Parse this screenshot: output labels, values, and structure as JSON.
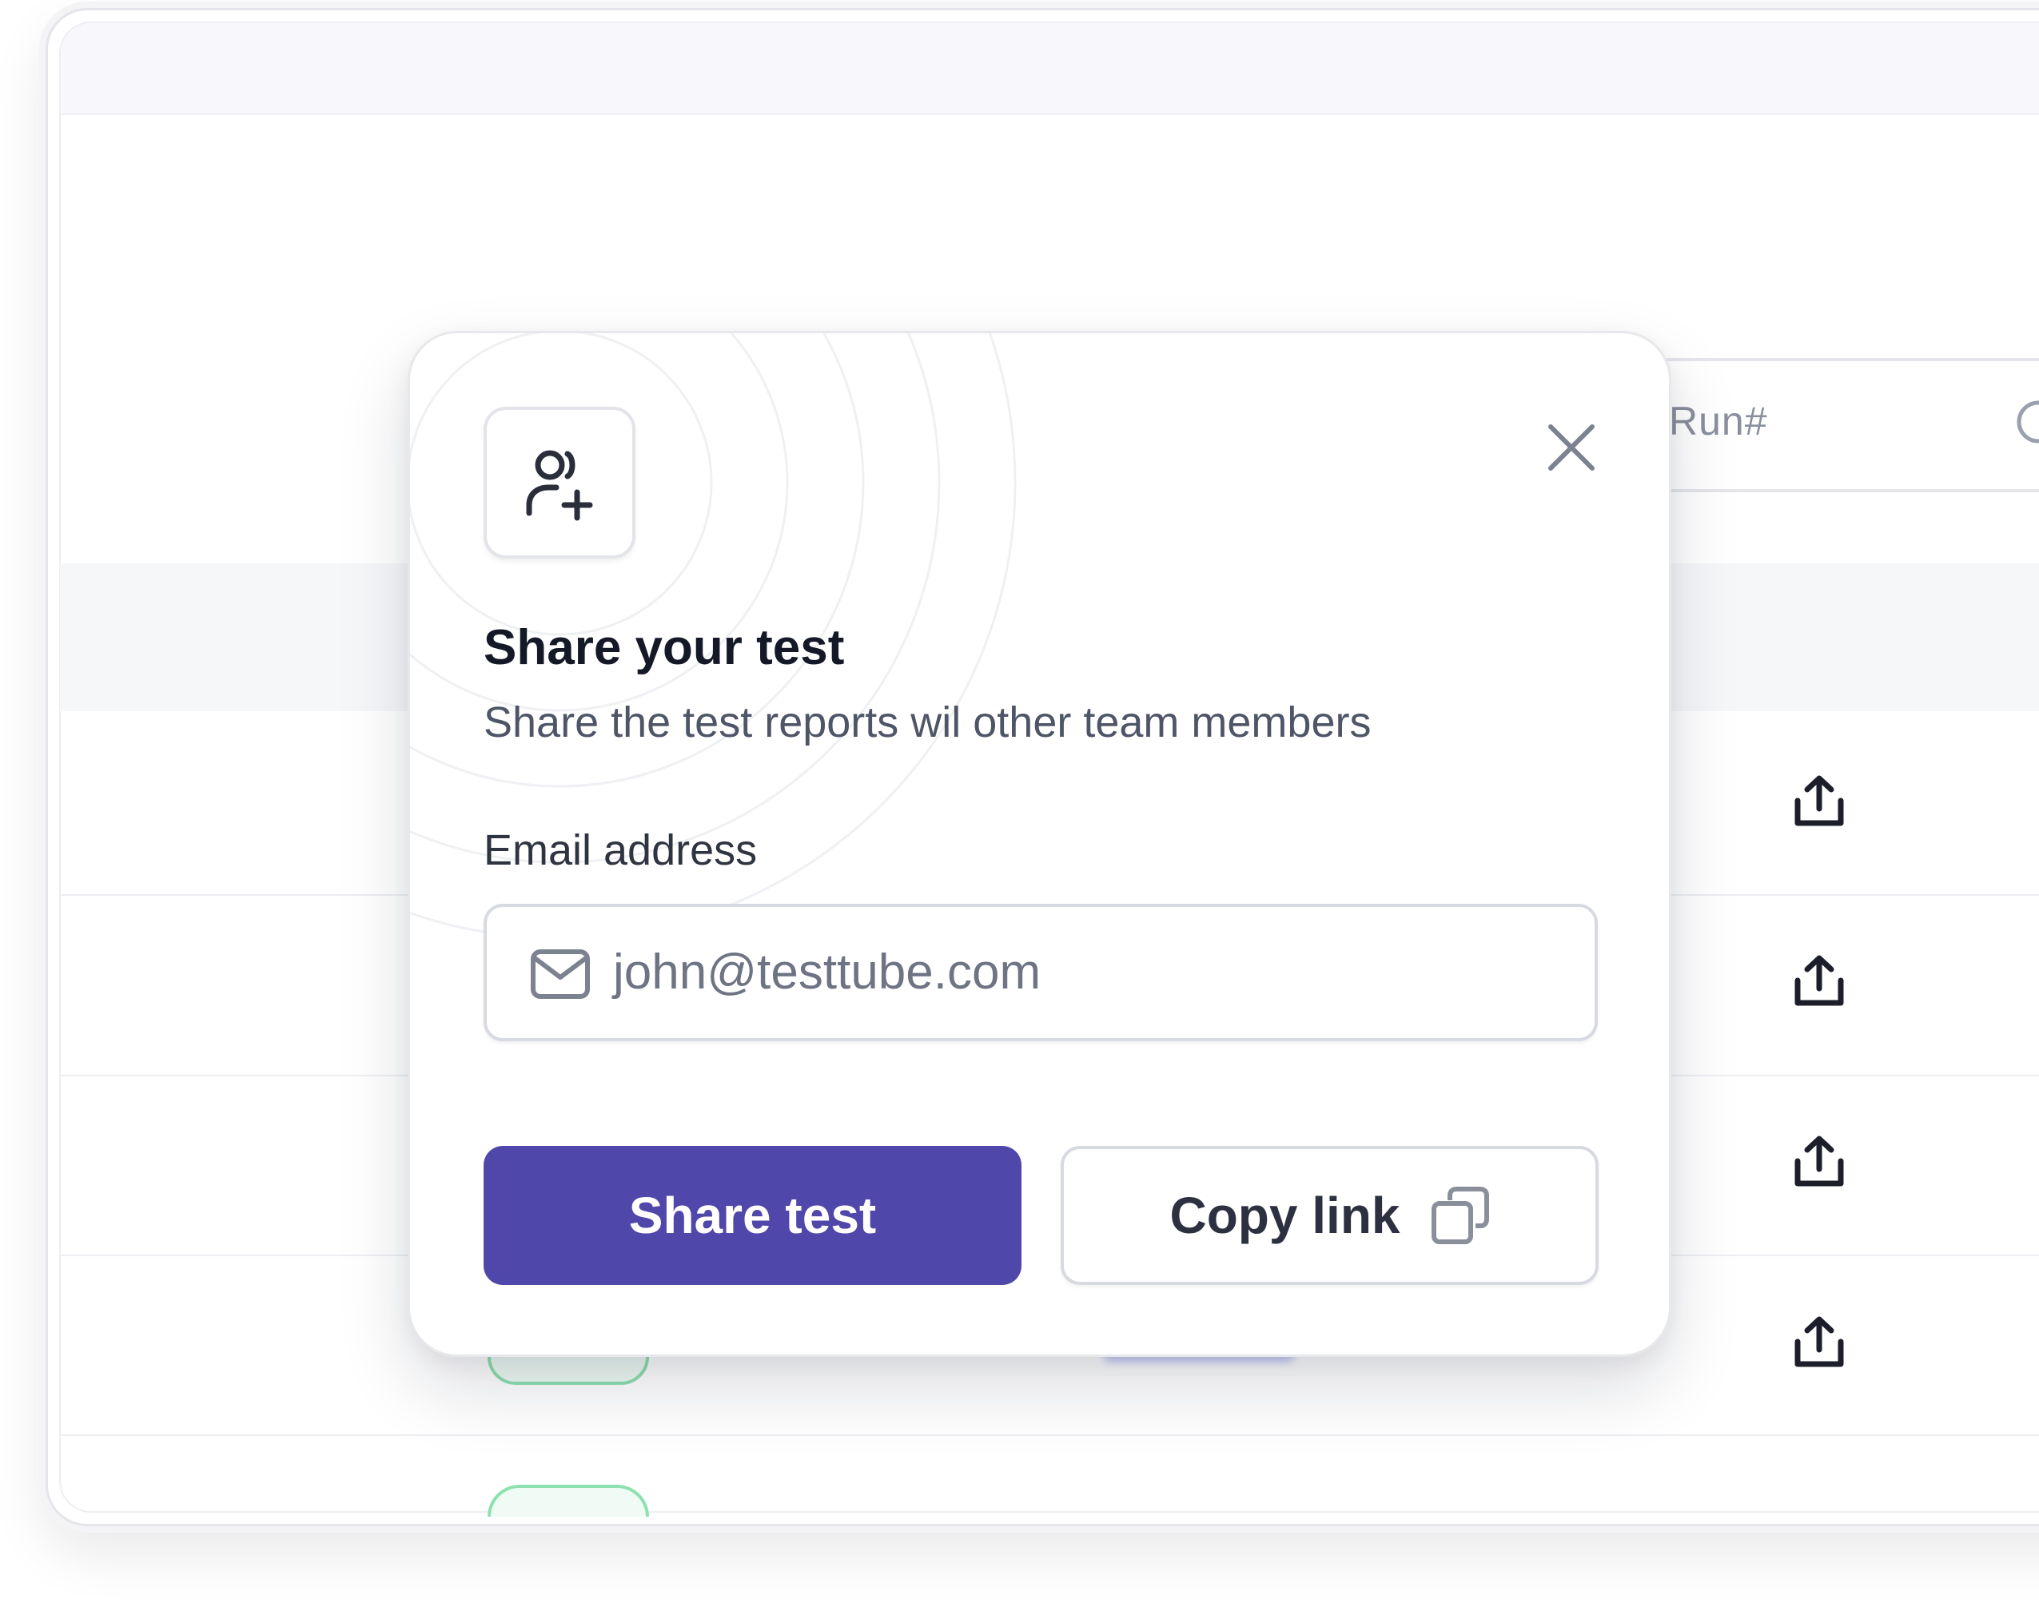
{
  "background": {
    "search": {
      "placeholder": "Run#"
    },
    "rows": [
      {
        "share_icon": "share-upload-icon"
      },
      {
        "share_icon": "share-upload-icon"
      },
      {
        "share_icon": "share-upload-icon"
      },
      {
        "share_icon": "share-upload-icon"
      }
    ]
  },
  "modal": {
    "icon": "add-user-icon",
    "title": "Share your test",
    "subtitle": "Share the test reports wil other team members",
    "email": {
      "label": "Email address",
      "value": "john@testtube.com",
      "icon": "mail-icon"
    },
    "primary_button": "Share test",
    "secondary_button": "Copy link",
    "close_icon": "close-icon",
    "copy_icon": "copy-icon"
  },
  "colors": {
    "primary": "#5047AA",
    "text_dark": "#151827",
    "text_muted": "#4E5566",
    "border": "#D7DAE0",
    "status_green": "#8EE0B0"
  }
}
